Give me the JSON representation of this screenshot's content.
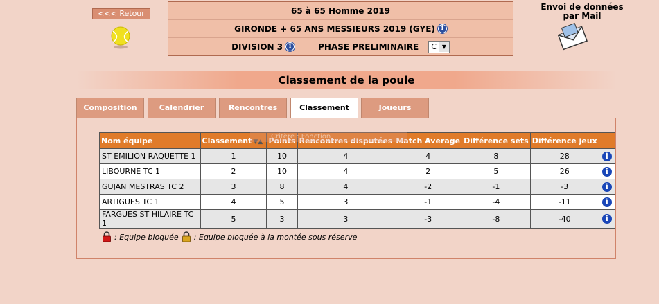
{
  "nav": {
    "back_label": "<<< Retour"
  },
  "header": {
    "line1": "65  à 65  Homme  2019",
    "line2": "GIRONDE + 65 ANS MESSIEURS 2019 (GYE)",
    "division_label": "DIVISION 3",
    "phase_label": "PHASE PRELIMINAIRE",
    "phase_select_value": "C"
  },
  "mail": {
    "title_line1": "Envoi de données",
    "title_line2": "par Mail"
  },
  "section_title": "Classement de la poule",
  "tabs": [
    {
      "label": "Composition"
    },
    {
      "label": "Calendrier"
    },
    {
      "label": "Rencontres"
    },
    {
      "label": "Classement",
      "active": true
    },
    {
      "label": "Joueurs"
    }
  ],
  "tooltip_ghost": "Critère : Fonction",
  "table": {
    "headers": [
      "Nom équipe",
      "Classement",
      "Points",
      "Rencontres disputées",
      "Match Average",
      "Différence sets",
      "Différence jeux"
    ],
    "rows": [
      {
        "team": "ST EMILION RAQUETTE 1",
        "rank": "1",
        "points": "10",
        "played": "4",
        "match_avg": "4",
        "diff_sets": "8",
        "diff_games": "28"
      },
      {
        "team": "LIBOURNE TC 1",
        "rank": "2",
        "points": "10",
        "played": "4",
        "match_avg": "2",
        "diff_sets": "5",
        "diff_games": "26"
      },
      {
        "team": "GUJAN MESTRAS TC 2",
        "rank": "3",
        "points": "8",
        "played": "4",
        "match_avg": "-2",
        "diff_sets": "-1",
        "diff_games": "-3"
      },
      {
        "team": "ARTIGUES TC 1",
        "rank": "4",
        "points": "5",
        "played": "3",
        "match_avg": "-1",
        "diff_sets": "-4",
        "diff_games": "-11"
      },
      {
        "team": "FARGUES ST HILAIRE TC 1",
        "rank": "5",
        "points": "3",
        "played": "3",
        "match_avg": "-3",
        "diff_sets": "-8",
        "diff_games": "-40"
      }
    ]
  },
  "legend": {
    "locked": ": Equipe bloquée",
    "locked_reserve": ": Equipe bloquée à la montée sous réserve"
  },
  "colors": {
    "accent": "#e07b2a",
    "background": "#f2d4c8",
    "info": "#1a47b8"
  }
}
